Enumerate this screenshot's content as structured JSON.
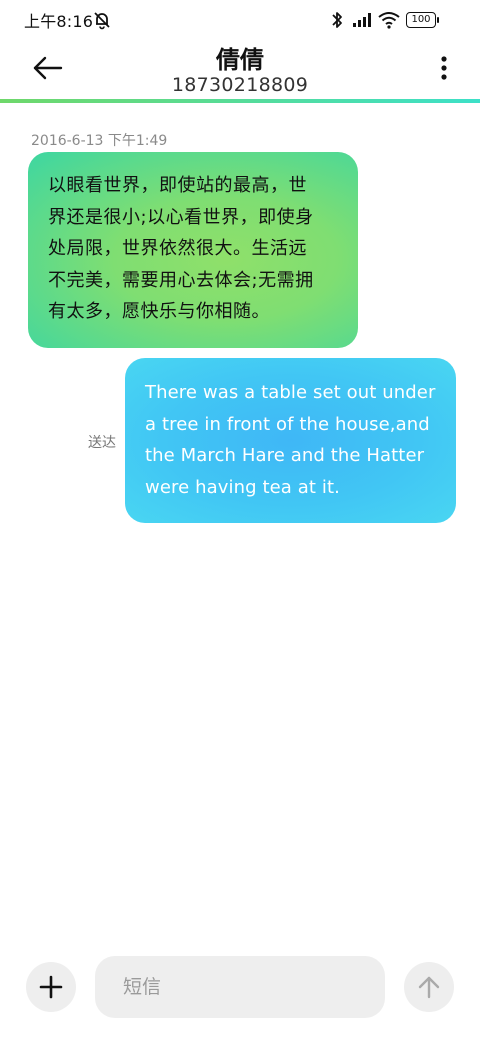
{
  "status_bar": {
    "time": "上午8:16",
    "battery": "100",
    "icons": [
      "dnd-off-icon",
      "bluetooth-icon",
      "signal-icon",
      "wifi-icon",
      "battery-icon"
    ]
  },
  "header": {
    "contact_name": "倩倩",
    "contact_number": "18730218809",
    "icons": [
      "back-arrow-icon",
      "more-vertical-icon"
    ],
    "accent_colors": [
      "#6fd86a",
      "#3de0c8"
    ]
  },
  "conversation": {
    "timestamp": "2016-6-13 下午1:49",
    "messages": [
      {
        "direction": "incoming",
        "lines": [
          "以眼看世界，即使站的最高，世",
          "界还是很小;以心看世界，即使身",
          "处局限，世界依然很大。生活远",
          "不完美，需要用心去体会;无需拥",
          "有太多，愿快乐与你相随。"
        ],
        "bubble_color": "#7fde72"
      },
      {
        "direction": "outgoing",
        "status": "送达",
        "lines": [
          "There was a table set out under",
          "a tree in front of the house,and",
          "the March Hare and the Hatter",
          "were having tea at it."
        ],
        "bubble_color": "#41c6f4"
      }
    ]
  },
  "composer": {
    "placeholder": "短信",
    "icons": [
      "plus-icon",
      "arrow-up-icon"
    ]
  }
}
